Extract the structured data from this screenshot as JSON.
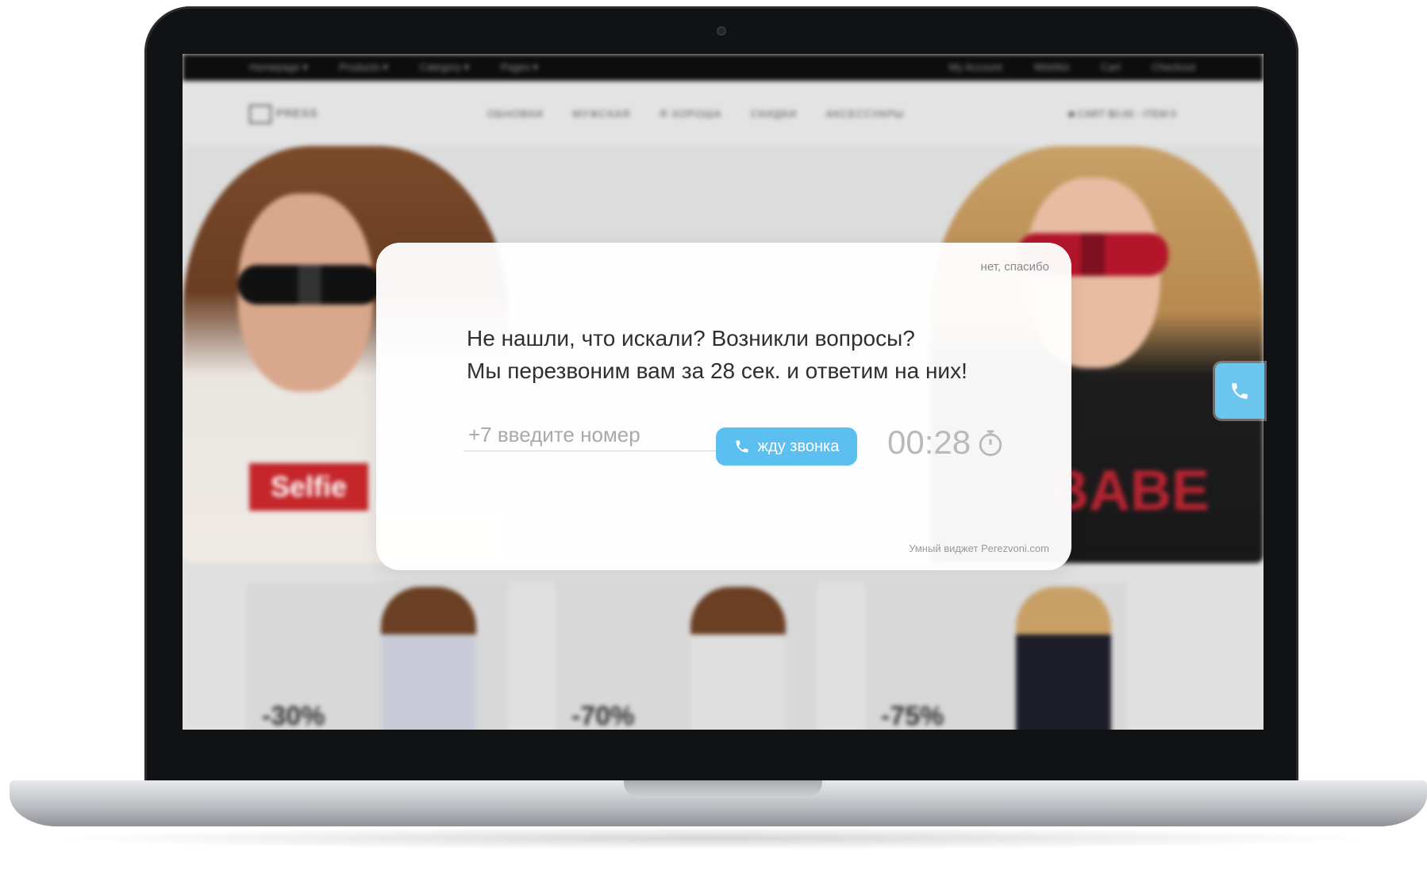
{
  "website": {
    "topbar_left": [
      "Homepage ▾",
      "Products ▾",
      "Category ▾",
      "Pages ▾"
    ],
    "topbar_right": [
      "My Account",
      "Wishlist",
      "Cart",
      "Checkout"
    ],
    "logo": "PRESS",
    "main_nav": [
      "ОБНОВКИ",
      "МУЖСКАЯ",
      "Я ХОРОША",
      "СКИДКИ",
      "АКСЕССУАРЫ"
    ],
    "cart": "■ CART $0.00 - ITEM 0",
    "hero_left_shirt": "Selfie",
    "hero_right_shirt": "BABE",
    "product_discounts": [
      "-30%",
      "-70%",
      "-75%"
    ]
  },
  "popup": {
    "dismiss_text": "нет, спасибо",
    "headline_line1": "Не нашли, что искали? Возникли вопросы?",
    "headline_line2": "Мы перезвоним вам за 28 сек. и ответим на них!",
    "phone_placeholder": "+7 введите номер",
    "phone_value": "",
    "button_label": "жду звонка",
    "timer": "00:28",
    "credit": "Умный виджет Perezvoni.com"
  },
  "colors": {
    "accent_button": "#5bbff0",
    "call_tab": "#6cc6ee"
  },
  "icons": {
    "button_icon": "phone-icon",
    "timer_icon": "stopwatch-icon",
    "side_tab_icon": "phone-icon"
  }
}
